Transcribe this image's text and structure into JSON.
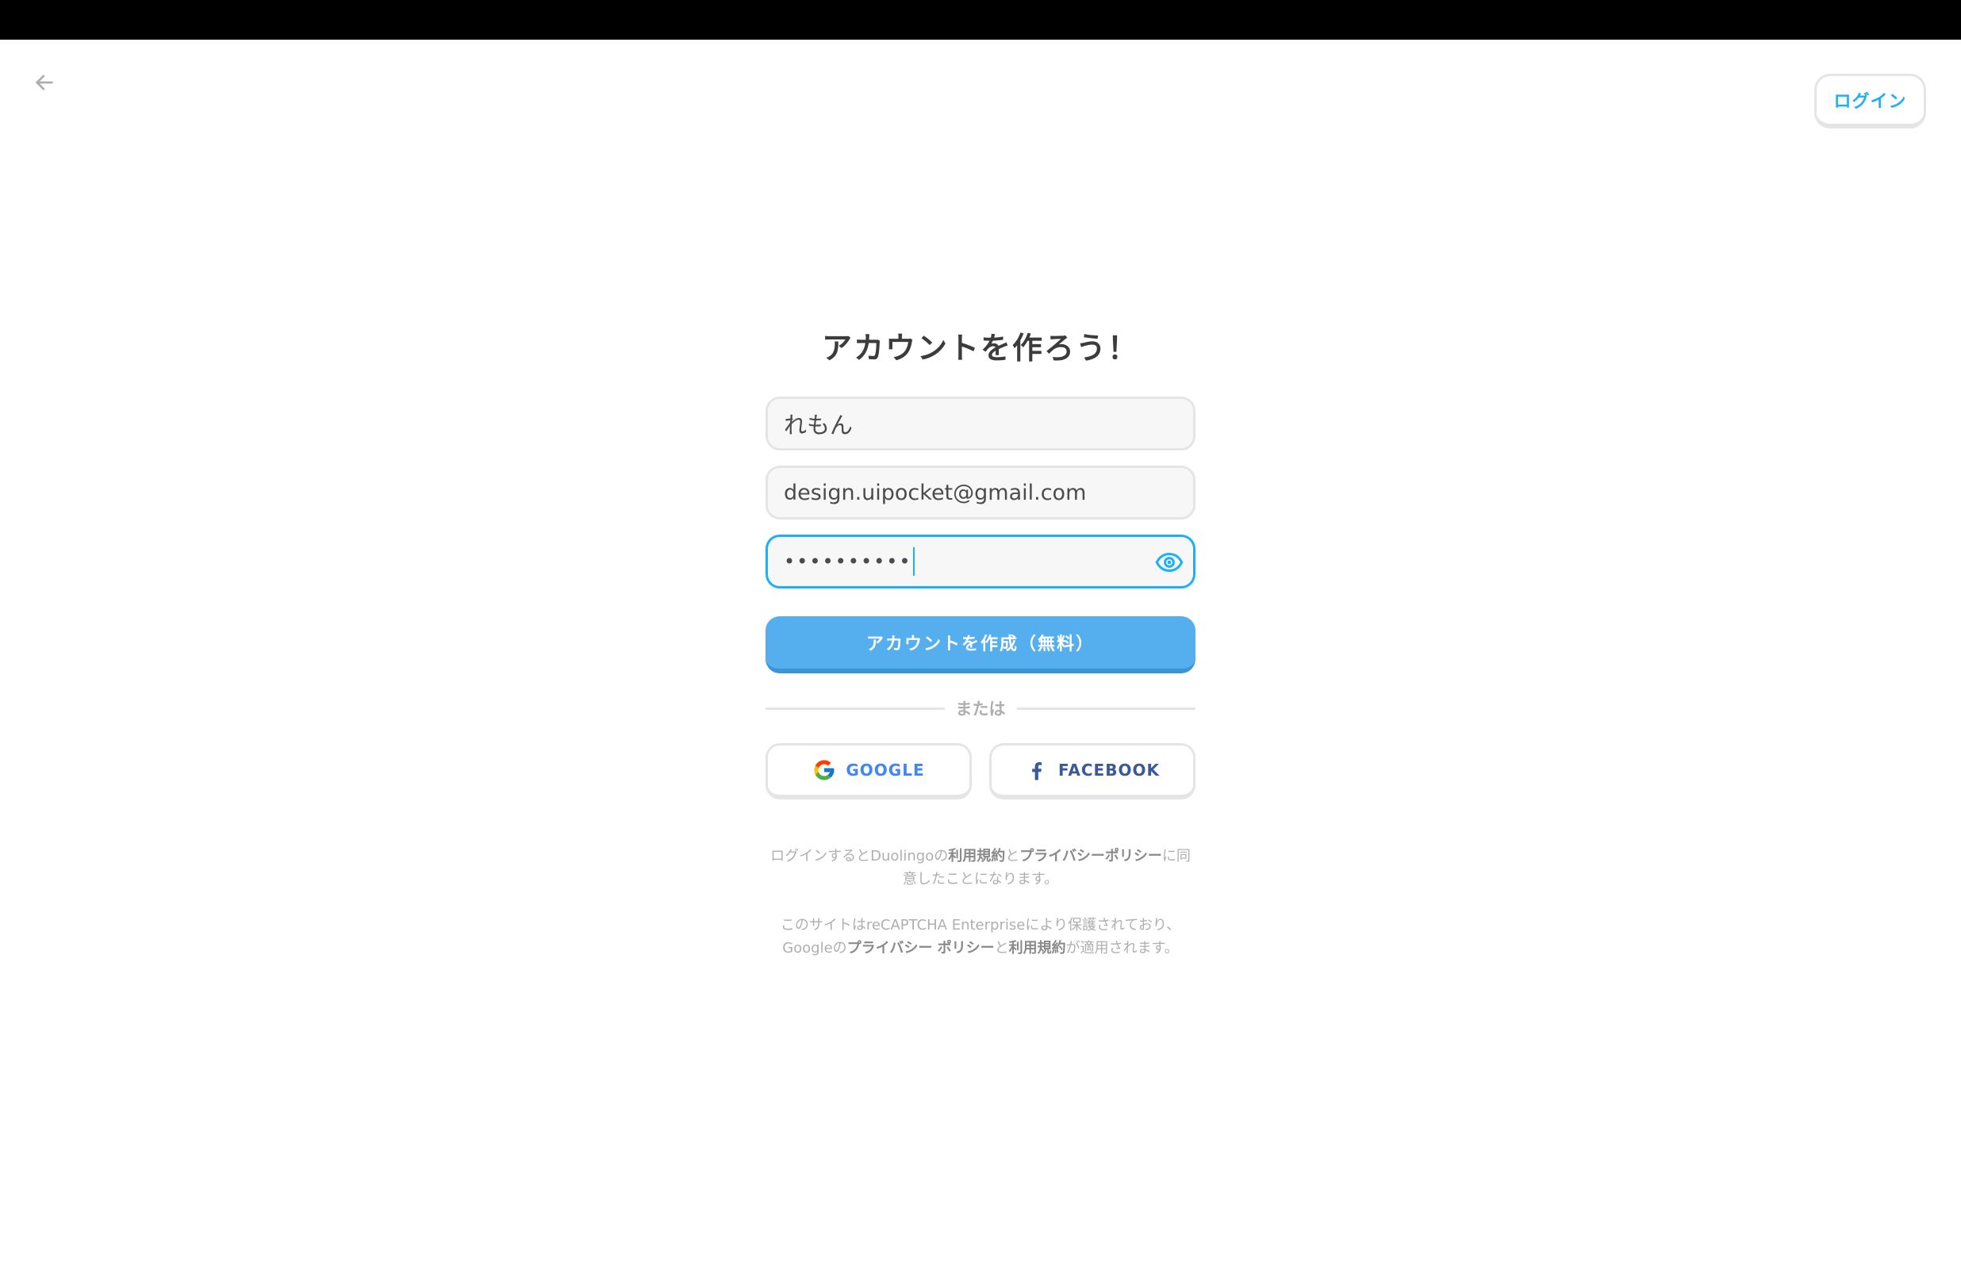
{
  "header": {
    "back_icon": "arrow-left-icon",
    "login_label": "ログイン"
  },
  "form": {
    "title": "アカウントを作ろう！",
    "name_value": "れもん",
    "email_value": "design.uipocket@gmail.com",
    "password_masked": "••••••••••",
    "eye_icon": "eye-icon",
    "create_label": "アカウントを作成（無料）",
    "divider_text": "または"
  },
  "social": {
    "google_label": "GOOGLE",
    "google_icon": "google-g-icon",
    "facebook_label": "FACEBOOK",
    "facebook_icon": "facebook-f-icon"
  },
  "legal": {
    "terms_pre": "ログインするとDuolingoの",
    "terms_link": "利用規約",
    "terms_and": "と",
    "privacy_link": "プライバシーポリシー",
    "terms_post": "に同意したことになります。",
    "recaptcha_pre": "このサイトはreCAPTCHA Enterpriseにより保護されており、Googleの",
    "recaptcha_privacy": "プライバシー ポリシー",
    "recaptcha_and": "と",
    "recaptcha_terms": "利用規約",
    "recaptcha_post": "が適用されます。"
  },
  "colors": {
    "accent": "#1cb0f6",
    "primary_button": "#55aeee",
    "title_text": "#3c3c3c",
    "muted_text": "#afafaf"
  }
}
